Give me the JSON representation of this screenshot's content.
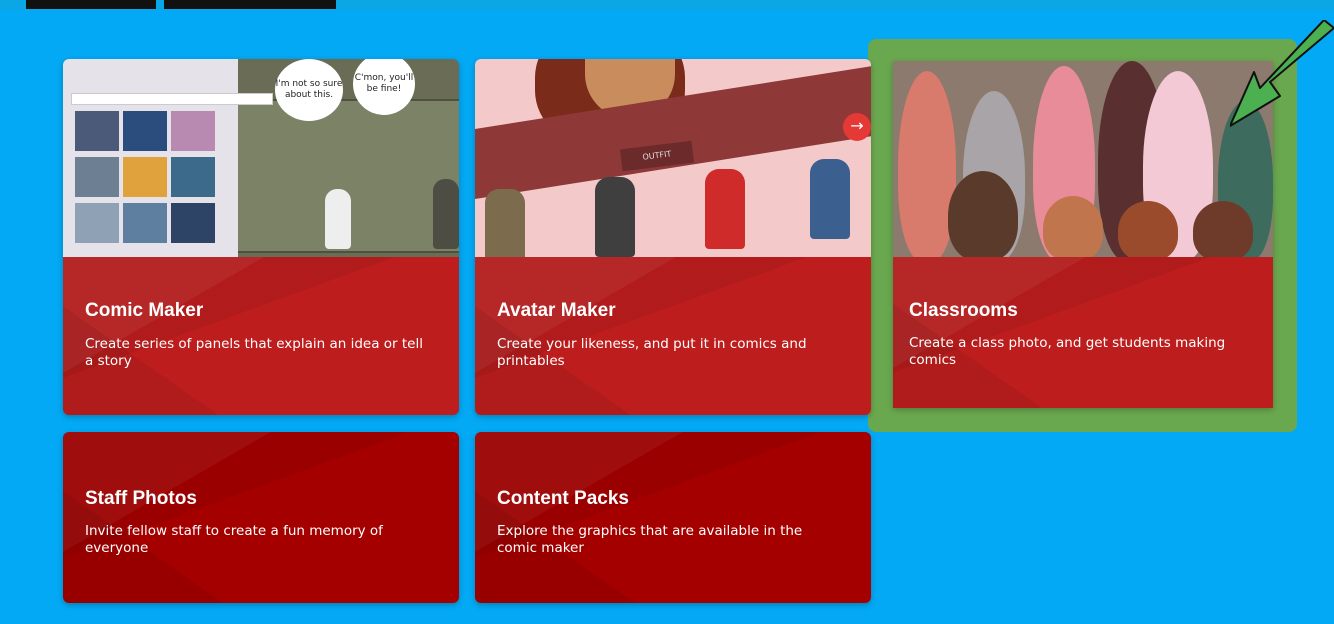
{
  "cards": {
    "comic_maker": {
      "title": "Comic Maker",
      "description": "Create series of panels that explain an idea or tell a story",
      "bubble_1": "I'm not so sure about this.",
      "bubble_2": "C'mon, you'll be fine!"
    },
    "avatar_maker": {
      "title": "Avatar Maker",
      "description": "Create your likeness, and put it in comics and printables",
      "outfit_label": "OUTFIT"
    },
    "classrooms": {
      "title": "Classrooms",
      "description": "Create a class photo, and get students making comics"
    },
    "staff_photos": {
      "title": "Staff Photos",
      "description": "Invite fellow staff to create a fun memory of everyone"
    },
    "content_packs": {
      "title": "Content Packs",
      "description": "Explore the graphics that are available in the comic maker"
    }
  },
  "colors": {
    "page_background": "#03a9f4",
    "card_red": "#bd1d1d",
    "card_dark_red": "#a40000",
    "highlight_green": "#6aa84f",
    "arrow_green": "#4caf50"
  }
}
